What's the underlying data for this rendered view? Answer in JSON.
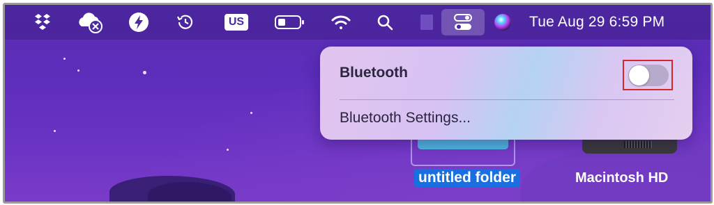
{
  "menubar": {
    "icons": [
      {
        "name": "dropbox-icon"
      },
      {
        "name": "icloud-disconnected-icon"
      },
      {
        "name": "lightning-icon"
      },
      {
        "name": "time-machine-icon"
      },
      {
        "name": "keyboard-input-source"
      },
      {
        "name": "battery-icon"
      },
      {
        "name": "wifi-icon"
      },
      {
        "name": "spotlight-search-icon"
      },
      {
        "name": "control-center-icon"
      },
      {
        "name": "siri-icon"
      }
    ],
    "input_source": "US",
    "datetime": "Tue Aug 29  6:59 PM"
  },
  "bluetooth_panel": {
    "title": "Bluetooth",
    "toggle_on": false,
    "settings_link": "Bluetooth Settings..."
  },
  "desktop": {
    "folder_label": "untitled folder",
    "disk_label": "Macintosh HD"
  },
  "colors": {
    "highlight_outline": "#d6262b",
    "selection_label": "#1a6fe0"
  }
}
